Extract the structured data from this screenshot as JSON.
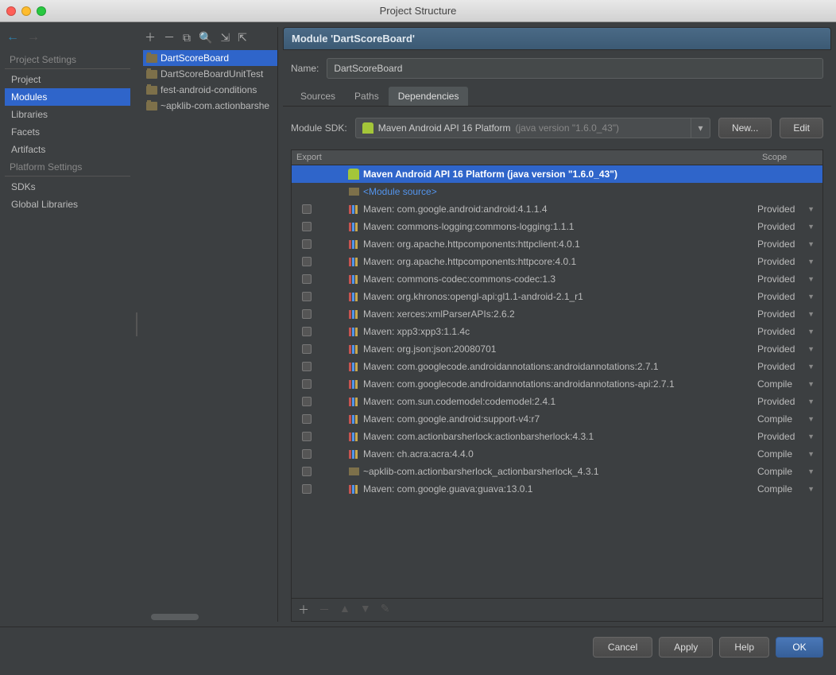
{
  "window": {
    "title": "Project Structure"
  },
  "nav": {
    "section1": "Project Settings",
    "section2": "Platform Settings",
    "items1": [
      "Project",
      "Modules",
      "Libraries",
      "Facets",
      "Artifacts"
    ],
    "items2": [
      "SDKs",
      "Global Libraries"
    ],
    "selected": "Modules"
  },
  "modules": {
    "list": [
      "DartScoreBoard",
      "DartScoreBoardUnitTest",
      "fest-android-conditions",
      "~apklib-com.actionbarshe"
    ],
    "selected": "DartScoreBoard"
  },
  "detail": {
    "panel_title": "Module 'DartScoreBoard'",
    "name_label": "Name:",
    "name_value": "DartScoreBoard",
    "tabs": [
      "Sources",
      "Paths",
      "Dependencies"
    ],
    "active_tab": "Dependencies",
    "sdk_label": "Module SDK:",
    "sdk_value": "Maven Android API 16 Platform",
    "sdk_hint": "(java version \"1.6.0_43\")",
    "new_btn": "New...",
    "edit_btn": "Edit",
    "cols": {
      "export": "Export",
      "scope": "Scope"
    },
    "deps": [
      {
        "type": "sdk",
        "text": "Maven Android API 16 Platform (java version \"1.6.0_43\")",
        "selected": true
      },
      {
        "type": "src",
        "text": "<Module source>"
      },
      {
        "type": "lib",
        "chk": false,
        "text": "Maven: com.google.android:android:4.1.1.4",
        "scope": "Provided"
      },
      {
        "type": "lib",
        "chk": false,
        "text": "Maven: commons-logging:commons-logging:1.1.1",
        "scope": "Provided"
      },
      {
        "type": "lib",
        "chk": false,
        "text": "Maven: org.apache.httpcomponents:httpclient:4.0.1",
        "scope": "Provided"
      },
      {
        "type": "lib",
        "chk": false,
        "text": "Maven: org.apache.httpcomponents:httpcore:4.0.1",
        "scope": "Provided"
      },
      {
        "type": "lib",
        "chk": false,
        "text": "Maven: commons-codec:commons-codec:1.3",
        "scope": "Provided"
      },
      {
        "type": "lib",
        "chk": false,
        "text": "Maven: org.khronos:opengl-api:gl1.1-android-2.1_r1",
        "scope": "Provided"
      },
      {
        "type": "lib",
        "chk": false,
        "text": "Maven: xerces:xmlParserAPIs:2.6.2",
        "scope": "Provided"
      },
      {
        "type": "lib",
        "chk": false,
        "text": "Maven: xpp3:xpp3:1.1.4c",
        "scope": "Provided"
      },
      {
        "type": "lib",
        "chk": false,
        "text": "Maven: org.json:json:20080701",
        "scope": "Provided"
      },
      {
        "type": "lib",
        "chk": false,
        "text": "Maven: com.googlecode.androidannotations:androidannotations:2.7.1",
        "scope": "Provided"
      },
      {
        "type": "lib",
        "chk": false,
        "text": "Maven: com.googlecode.androidannotations:androidannotations-api:2.7.1",
        "scope": "Compile"
      },
      {
        "type": "lib",
        "chk": false,
        "text": "Maven: com.sun.codemodel:codemodel:2.4.1",
        "scope": "Provided"
      },
      {
        "type": "lib",
        "chk": false,
        "text": "Maven: com.google.android:support-v4:r7",
        "scope": "Compile"
      },
      {
        "type": "lib",
        "chk": false,
        "text": "Maven: com.actionbarsherlock:actionbarsherlock:4.3.1",
        "scope": "Provided"
      },
      {
        "type": "lib",
        "chk": false,
        "text": "Maven: ch.acra:acra:4.4.0",
        "scope": "Compile"
      },
      {
        "type": "mod",
        "chk": false,
        "text": "~apklib-com.actionbarsherlock_actionbarsherlock_4.3.1",
        "scope": "Compile"
      },
      {
        "type": "lib",
        "chk": false,
        "text": "Maven: com.google.guava:guava:13.0.1",
        "scope": "Compile"
      }
    ]
  },
  "footer": {
    "cancel": "Cancel",
    "apply": "Apply",
    "help": "Help",
    "ok": "OK"
  }
}
